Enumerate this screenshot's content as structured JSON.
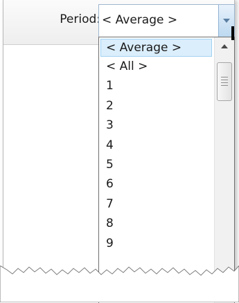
{
  "header": {
    "period_label": "Period:",
    "period_value": "< Average >"
  },
  "dropdown": {
    "items": [
      "< Average >",
      "< All >",
      "1",
      "2",
      "3",
      "4",
      "5",
      "6",
      "7",
      "8",
      "9"
    ],
    "selected_index": 0
  },
  "colors": {
    "selection_bg": "#dbeefb",
    "selection_border": "#9fd2f4",
    "combo_button": "#bcd8f0"
  },
  "icons": {
    "combo_arrow": "chevron-down-icon",
    "scroll_up": "scroll-up-arrow-icon"
  }
}
